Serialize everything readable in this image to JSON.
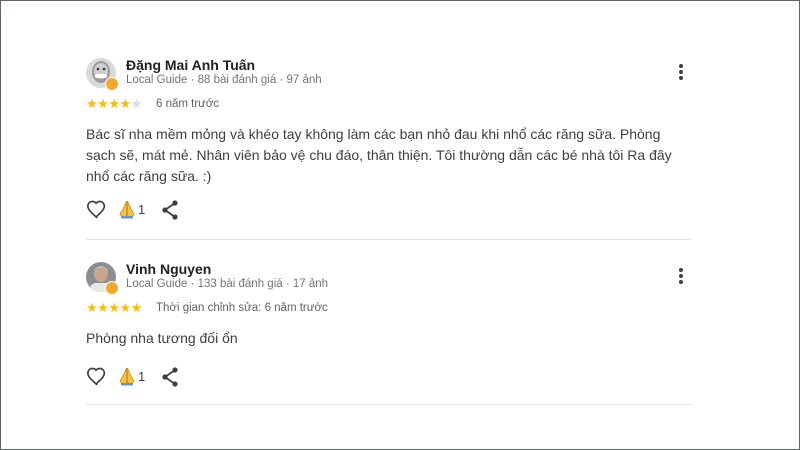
{
  "reviews": [
    {
      "author": "Đặng Mai Anh Tuấn",
      "meta": "Local Guide · 88 bài đánh giá · 97 ảnh",
      "rating": 4,
      "rating_max": 5,
      "time": "6 năm trước",
      "text": "Bác sĩ nha mềm mỏng và khéo tay không làm các bạn nhỏ đau khi nhổ các răng sữa. Phòng sạch sẽ, mát mẻ. Nhân viên bảo vệ chu đáo, thân thiện. Tôi thường dẫn các bé nhà tôi Ra đây nhổ các răng sữa. :)",
      "reaction_count": "1"
    },
    {
      "author": "Vinh Nguyen",
      "meta": "Local Guide · 133 bài đánh giá · 17 ảnh",
      "rating": 5,
      "rating_max": 5,
      "time": "Thời gian chỉnh sửa: 6 năm trước",
      "text": "Phòng nha tương đối ổn",
      "reaction_count": "1"
    }
  ],
  "icons": {
    "like": "heart-outline-icon",
    "react": "praying-hands-icon",
    "share": "share-icon",
    "more": "more-vert-icon",
    "badge": "local-guide-badge-icon"
  },
  "colors": {
    "star": "#fbbc04",
    "star_empty": "#dadce0",
    "badge": "#f4a82e",
    "text": "#3c4043",
    "meta": "#70757a"
  }
}
